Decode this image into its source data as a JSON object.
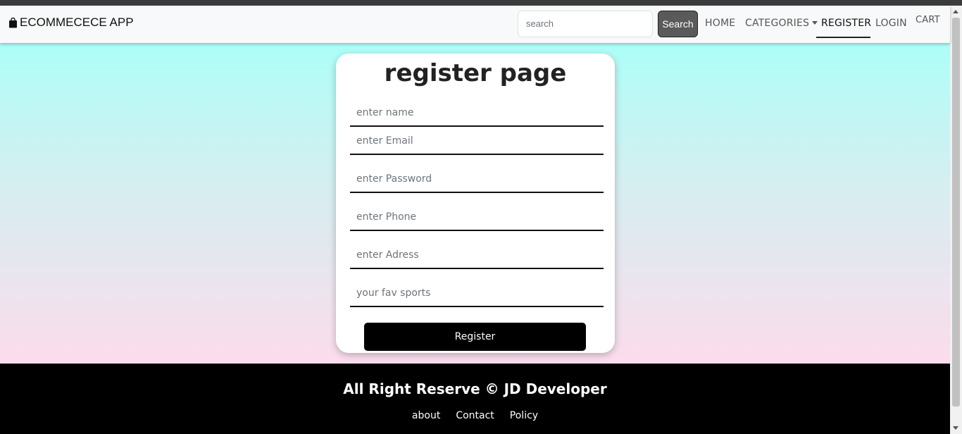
{
  "navbar": {
    "brand": "ECOMMECECE APP",
    "brand_icon": "shopping-bag-icon",
    "search_placeholder": "search",
    "search_button": "Search",
    "links": {
      "home": "HOME",
      "categories": "CATEGORIES",
      "register": "REGISTER",
      "login": "LOGIN",
      "cart": "CART"
    }
  },
  "form": {
    "title": "register page",
    "fields": {
      "name": "enter name",
      "email": "enter Email",
      "password": "enter Password",
      "phone": "enter Phone",
      "address": "enter Adress",
      "answer": "your fav sports"
    },
    "submit": "Register"
  },
  "footer": {
    "text": "All Right Reserve © JD Developer",
    "links": {
      "about": "about",
      "contact": "Contact",
      "policy": "Policy"
    }
  },
  "colors": {
    "gradient_top": "#adfef8",
    "gradient_bottom": "#fcdcec",
    "button": "#000000",
    "search_button": "#5a5a5a"
  }
}
